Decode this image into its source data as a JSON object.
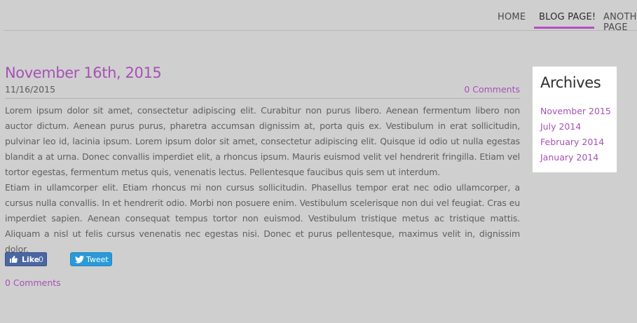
{
  "nav": {
    "items": [
      {
        "label": "HOME"
      },
      {
        "label": "BLOG PAGE!"
      },
      {
        "label": "ANOTHER PAGE"
      }
    ],
    "active_index": 1,
    "accent_color": "#b44fc0"
  },
  "post": {
    "title": "November 16th, 2015",
    "date": "11/16/2015",
    "comments_top": "0 Comments",
    "paragraphs": [
      "Lorem ipsum dolor sit amet, consectetur adipiscing elit. Curabitur non purus libero. Aenean fermentum libero non auctor dictum. Aenean purus purus, pharetra accumsan dignissim at, porta quis ex. Vestibulum in erat sollicitudin, pulvinar leo id, lacinia ipsum. Lorem ipsum dolor sit amet, consectetur adipiscing elit. Quisque id odio ut nulla egestas blandit a at urna. Donec convallis imperdiet elit, a rhoncus ipsum. Mauris euismod velit vel hendrerit fringilla. Etiam vel tortor egestas, fermentum metus quis, venenatis lectus. Pellentesque faucibus quis sem ut interdum.",
      "Etiam in ullamcorper elit. Etiam rhoncus mi non cursus sollicitudin. Phasellus tempor erat nec odio ullamcorper, a cursus nulla convallis. In et hendrerit odio. Morbi non posuere enim. Vestibulum scelerisque non dui vel feugiat. Cras eu imperdiet sapien. Aenean consequat tempus tortor non euismod. Vestibulum tristique metus ac tristique mattis. Aliquam a nisl ut felis cursus venenatis nec egestas nisi. Donec et purus pellentesque, maximus velit in, dignissim dolor."
    ],
    "like_label": "Like",
    "like_count": "0",
    "tweet_label": "Tweet",
    "comments_bottom": "0 Comments",
    "link_color": "#a552b4"
  },
  "archives": {
    "title": "Archives",
    "items": [
      {
        "label": "November 2015"
      },
      {
        "label": "July 2014"
      },
      {
        "label": "February 2014"
      },
      {
        "label": "January 2014"
      }
    ]
  },
  "colors": {
    "background": "#d0cfd0",
    "facebook": "#4b67a1",
    "twitter": "#2a9ad8"
  },
  "icons": {
    "like": "thumbs-up-icon",
    "tweet": "twitter-bird-icon"
  }
}
